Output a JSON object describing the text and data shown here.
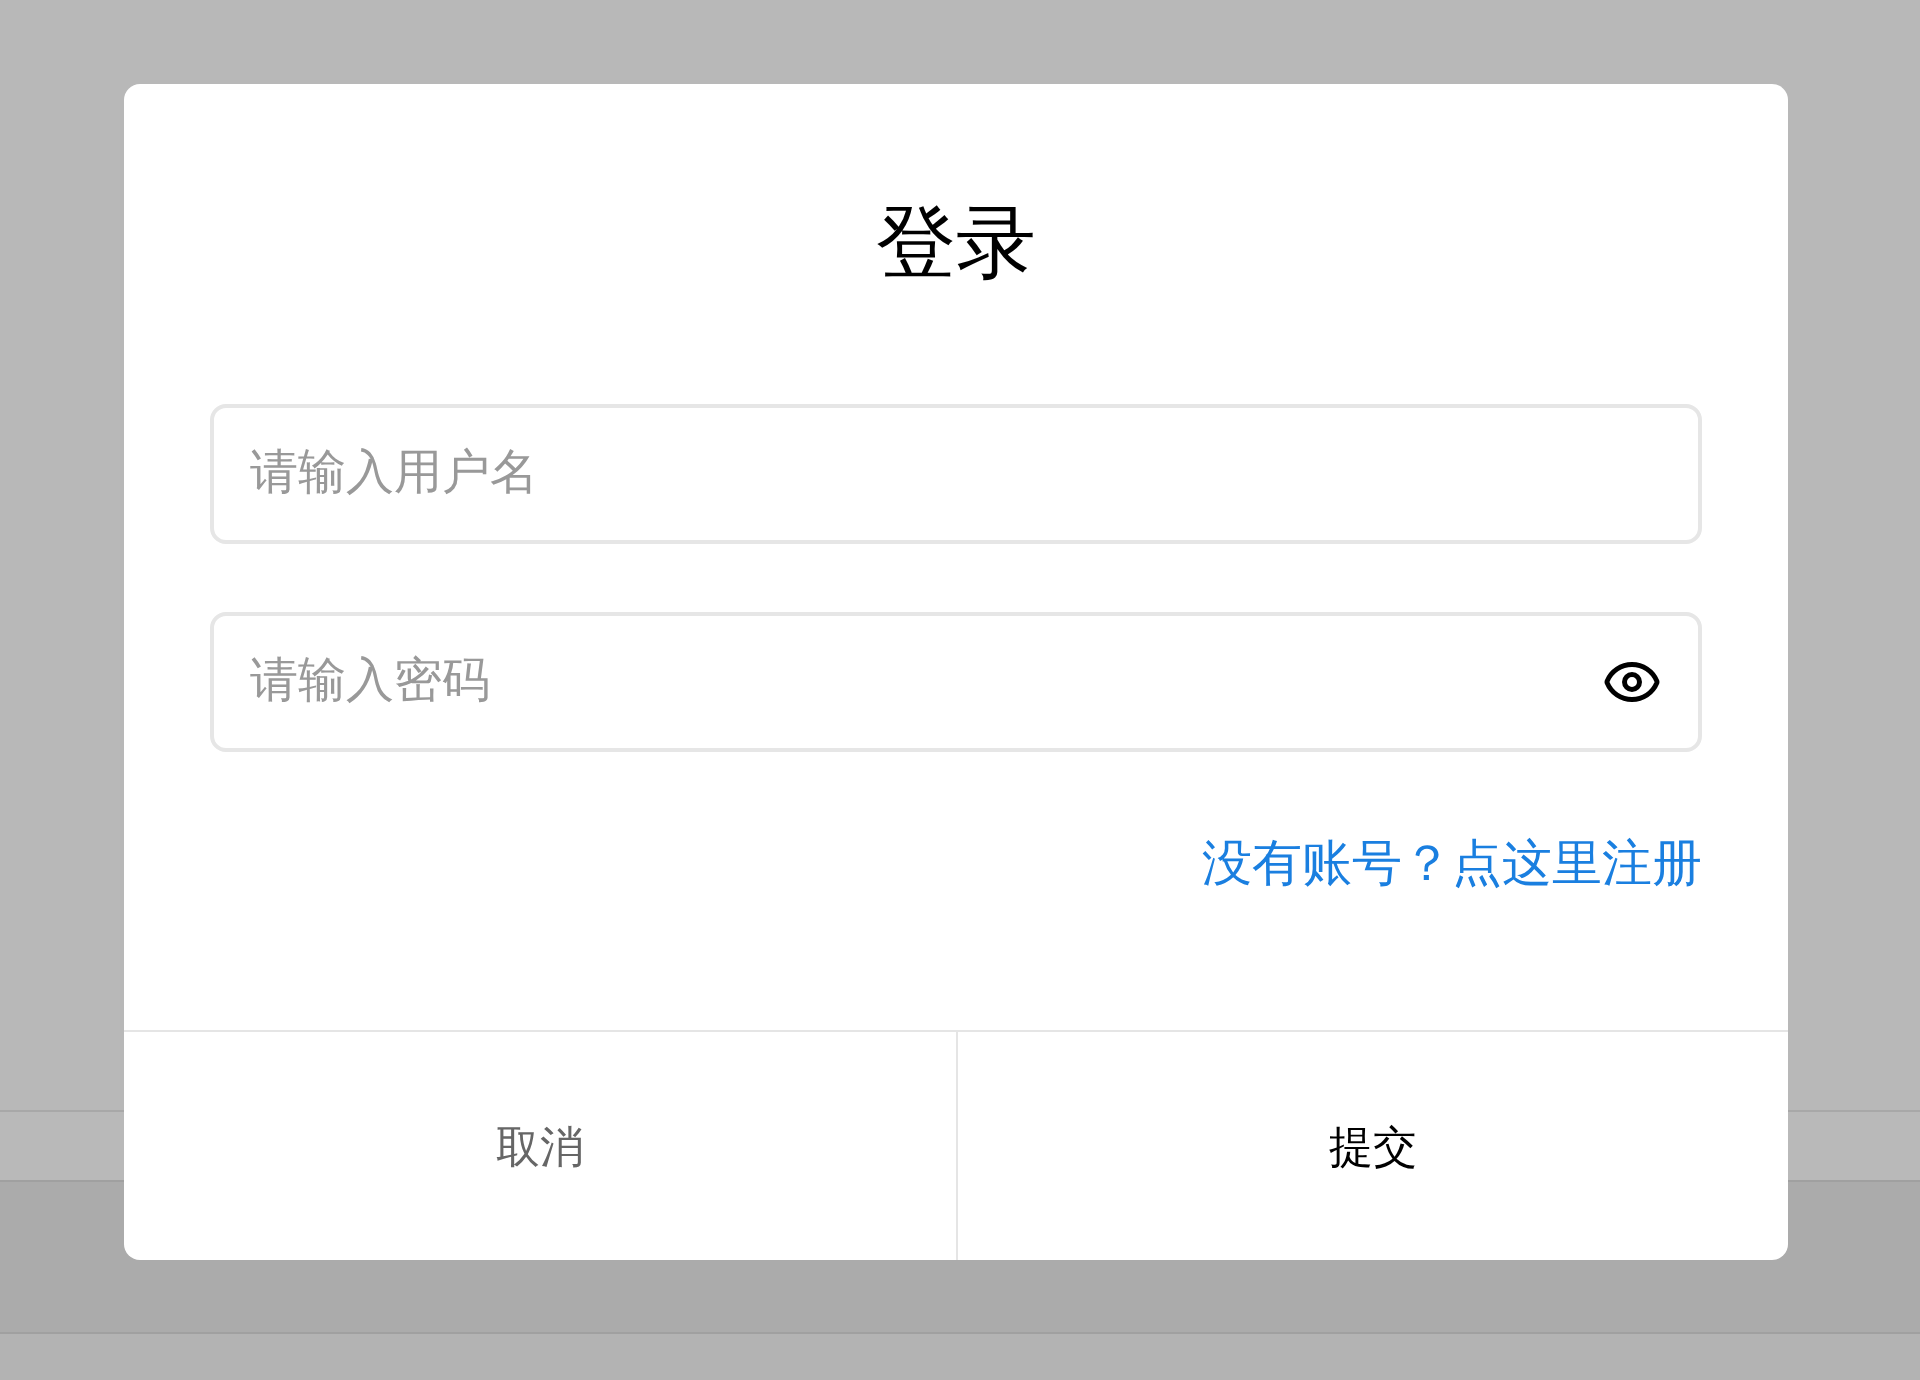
{
  "dialog": {
    "title": "登录",
    "fields": [
      {
        "kind": "text",
        "placeholder": "请输入用户名"
      },
      {
        "kind": "password",
        "placeholder": "请输入密码"
      }
    ],
    "register_link": "没有账号？点这里注册",
    "buttons": [
      {
        "kind": "cancel",
        "label": "取消"
      },
      {
        "kind": "submit",
        "label": "提交"
      }
    ]
  }
}
